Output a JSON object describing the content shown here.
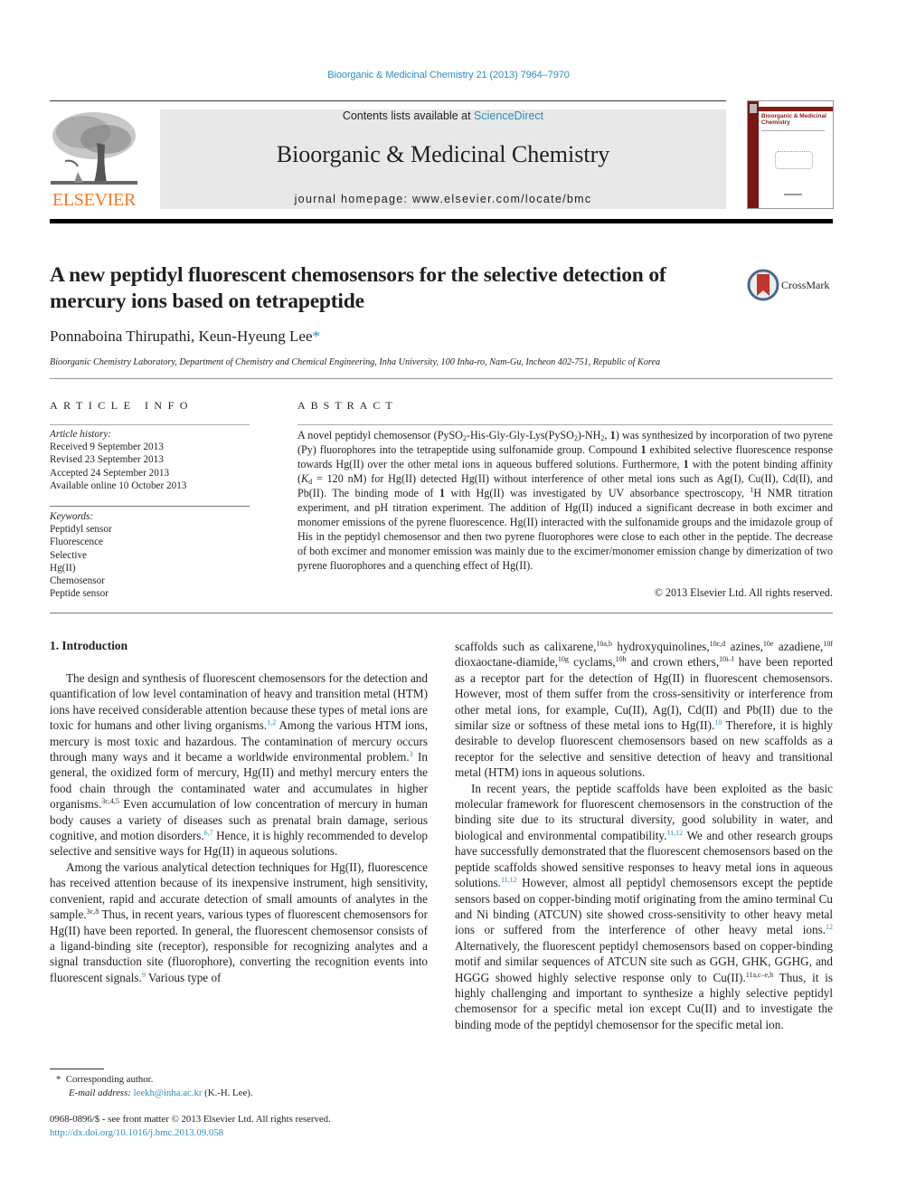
{
  "header": {
    "journal_reference": "Bioorganic & Medicinal Chemistry 21 (2013) 7964–7970",
    "contents_prefix": "Contents lists available at ",
    "contents_link": "ScienceDirect",
    "journal_title": "Bioorganic & Medicinal Chemistry",
    "homepage": "journal homepage: www.elsevier.com/locate/bmc",
    "publisher_logo_text": "ELSEVIER",
    "cover_title": "Bioorganic & Medicinal Chemistry",
    "brand_color": "#f47920",
    "link_color": "#2a8fbd"
  },
  "article": {
    "title": "A new peptidyl fluorescent chemosensors for the selective detection of mercury ions based on tetrapeptide",
    "crossmark_label": "CrossMark",
    "authors": "Ponnaboina Thirupathi, Keun-Hyeung Lee",
    "author_mark": "*",
    "affiliation": "Bioorganic Chemistry Laboratory, Department of Chemistry and Chemical Engineering, Inha University, 100 Inha-ro, Nam-Gu, Incheon 402-751, Republic of Korea"
  },
  "article_info": {
    "heading": "ARTICLE INFO",
    "history_label": "Article history:",
    "history": [
      "Received 9 September 2013",
      "Revised 23 September 2013",
      "Accepted 24 September 2013",
      "Available online 10 October 2013"
    ],
    "keywords_label": "Keywords:",
    "keywords": [
      "Peptidyl sensor",
      "Fluorescence",
      "Selective",
      "Hg(II)",
      "Chemosensor",
      "Peptide sensor"
    ]
  },
  "abstract": {
    "heading": "ABSTRACT",
    "parts": {
      "a1": "A novel peptidyl chemosensor (PySO",
      "a2": "-His-Gly-Gly-Lys(PySO",
      "a3": ")-NH",
      "a4": ", ",
      "a5": "1",
      "a6": ") was synthesized by incorporation of two pyrene (Py) fluorophores into the tetrapeptide using sulfonamide group. Compound ",
      "a7": "1",
      "a8": " exhibited selective fluorescence response towards Hg(II) over the other metal ions in aqueous buffered solutions. Furthermore, ",
      "a9": "1",
      "a10": " with the potent binding affinity (",
      "a11": "K",
      "a12": "d",
      "a13": " = 120 nM) for Hg(II) detected Hg(II) without interference of other metal ions such as Ag(I), Cu(II), Cd(II), and Pb(II). The binding mode of ",
      "a14": "1",
      "a15": " with Hg(II) was investigated by UV absorbance spectroscopy, ",
      "a16": "1",
      "a17": "H NMR titration experiment, and pH titration experiment. The addition of Hg(II) induced a significant decrease in both excimer and monomer emissions of the pyrene fluorescence. Hg(II) interacted with the sulfonamide groups and the imidazole group of His in the peptidyl chemosensor and then two pyrene fluorophores were close to each other in the peptide. The decrease of both excimer and monomer emission was mainly due to the excimer/monomer emission change by dimerization of two pyrene fluorophores and a quenching effect of Hg(II).",
      "sub2": "2"
    },
    "copyright": "© 2013 Elsevier Ltd. All rights reserved."
  },
  "introduction": {
    "heading": "1. Introduction",
    "p1": {
      "t1": "The design and synthesis of fluorescent chemosensors for the detection and quantification of low level contamination of heavy and transition metal (HTM) ions have received considerable attention because these types of metal ions are toxic for humans and other living organisms.",
      "c1": "1,2",
      "t2": " Among the various HTM ions, mercury is most toxic and hazardous. The contamination of mercury occurs through many ways and it became a worldwide environmental problem.",
      "c2": "3",
      "t3": " In general, the oxidized form of mercury, Hg(II) and methyl mercury enters the food chain through the contaminated water and accumulates in higher organisms.",
      "c3": "3c,4,5",
      "t4": " Even accumulation of low concentration of mercury in human body causes a variety of diseases such as prenatal brain damage, serious cognitive, and motion disorders.",
      "c4": "6,7",
      "t5": " Hence, it is highly recommended to develop selective and sensitive ways for Hg(II) in aqueous solutions."
    },
    "p2": {
      "t1": "Among the various analytical detection techniques for Hg(II), fluorescence has received attention because of its inexpensive instrument, high sensitivity, convenient, rapid and accurate detection of small amounts of analytes in the sample.",
      "c1": "3c,8",
      "t2": " Thus, in recent years, various types of fluorescent chemosensors for Hg(II) have been reported. In general, the fluorescent chemosensor consists of a ligand-binding site (receptor), responsible for recognizing analytes and a signal transduction site (fluorophore), converting the recognition events into fluorescent signals.",
      "c2": "9",
      "t3": " Various type of"
    },
    "p3": {
      "t1": "scaffolds such as calixarene,",
      "c1": "10a,b",
      "t2": " hydroxyquinolines,",
      "c2": "10c,d",
      "t3": " azines,",
      "c3": "10e",
      "t4": " azadiene,",
      "c4": "10f",
      "t5": " dioxaoctane-diamide,",
      "c5": "10g",
      "t6": " cyclams,",
      "c6": "10h",
      "t7": " and crown ethers,",
      "c7": "10i–l",
      "t8": " have been reported as a receptor part for the detection of Hg(II) in fluorescent chemosensors. However, most of them suffer from the cross-sensitivity or interference from other metal ions, for example, Cu(II), Ag(I), Cd(II) and Pb(II) due to the similar size or softness of these metal ions to Hg(II).",
      "c8": "10",
      "t9": " Therefore, it is highly desirable to develop fluorescent chemosensors based on new scaffolds as a receptor for the selective and sensitive detection of heavy and transitional metal (HTM) ions in aqueous solutions."
    },
    "p4": {
      "t1": "In recent years, the peptide scaffolds have been exploited as the basic molecular framework for fluorescent chemosensors in the construction of the binding site due to its structural diversity, good solubility in water, and biological and environmental compatibility.",
      "c1": "11,12",
      "t2": " We and other research groups have successfully demonstrated that the fluorescent chemosensors based on the peptide scaffolds showed sensitive responses to heavy metal ions in aqueous solutions.",
      "c2": "11,12",
      "t3": " However, almost all peptidyl chemosensors except the peptide sensors based on copper-binding motif originating from the amino terminal Cu and Ni binding (ATCUN) site showed cross-sensitivity to other heavy metal ions or suffered from the interference of other heavy metal ions.",
      "c3": "12",
      "t4": " Alternatively, the fluorescent peptidyl chemosensors based on copper-binding motif and similar sequences of ATCUN site such as GGH, GHK, GGHG, and HGGG showed highly selective response only to Cu(II).",
      "c4": "11a,c–e,h",
      "t5": " Thus, it is highly challenging and important to synthesize a highly selective peptidyl chemosensor for a specific metal ion except Cu(II) and to investigate the binding mode of the peptidyl chemosensor for the specific metal ion."
    }
  },
  "footnote": {
    "mark": "*",
    "corresponding": "Corresponding author.",
    "email_label": "E-mail address:",
    "email": "leekh@inha.ac.kr",
    "email_suffix": "(K.-H. Lee)."
  },
  "front_matter": {
    "issn_line": "0968-0896/$ - see front matter © 2013 Elsevier Ltd. All rights reserved.",
    "doi": "http://dx.doi.org/10.1016/j.bmc.2013.09.058"
  }
}
